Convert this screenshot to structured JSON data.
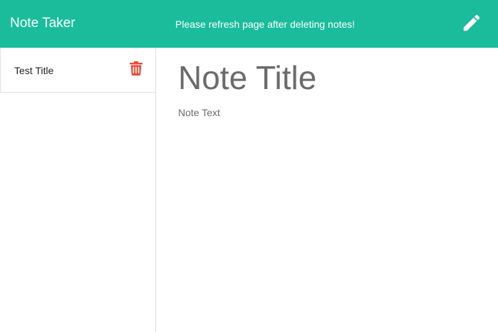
{
  "app": {
    "brand": "Note Taker",
    "notice": "Please refresh page after deleting notes!",
    "new_note_icon": "pencil-icon"
  },
  "colors": {
    "accent": "#1abc9c",
    "delete": "#e74c3c",
    "text_muted": "#6b6b6b"
  },
  "sidebar": {
    "notes": [
      {
        "title": "Test Title",
        "delete_icon": "trash-icon"
      }
    ]
  },
  "editor": {
    "title_placeholder": "Note Title",
    "text_placeholder": "Note Text"
  }
}
